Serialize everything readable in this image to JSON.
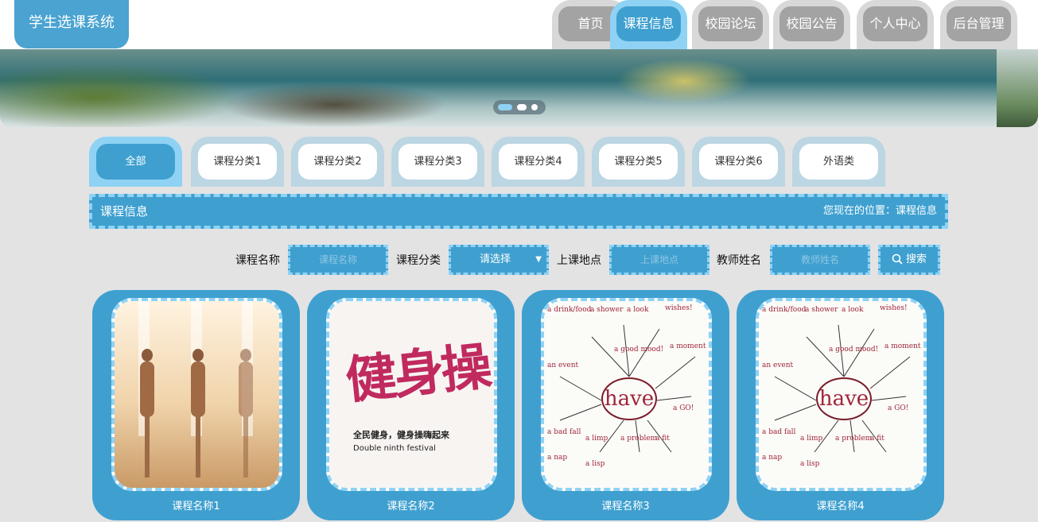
{
  "brand": "学生选课系统",
  "nav": [
    {
      "label": "首页",
      "active": false
    },
    {
      "label": "课程信息",
      "active": true
    },
    {
      "label": "校园论坛",
      "active": false
    },
    {
      "label": "校园公告",
      "active": false
    },
    {
      "label": "个人中心",
      "active": false
    },
    {
      "label": "后台管理",
      "active": false
    }
  ],
  "categories": [
    {
      "label": "全部",
      "active": true
    },
    {
      "label": "课程分类1"
    },
    {
      "label": "课程分类2"
    },
    {
      "label": "课程分类3"
    },
    {
      "label": "课程分类4"
    },
    {
      "label": "课程分类5"
    },
    {
      "label": "课程分类6"
    },
    {
      "label": "外语类"
    }
  ],
  "section": {
    "title": "课程信息",
    "breadcrumb": "您现在的位置：课程信息"
  },
  "search": {
    "course_name_label": "课程名称",
    "course_name_placeholder": "课程名称",
    "category_label": "课程分类",
    "category_selected": "请选择",
    "location_label": "上课地点",
    "location_placeholder": "上课地点",
    "teacher_label": "教师姓名",
    "teacher_placeholder": "教师姓名",
    "button": "搜索"
  },
  "courses": [
    {
      "name": "课程名称1"
    },
    {
      "name": "课程名称2"
    },
    {
      "name": "课程名称3"
    },
    {
      "name": "课程名称4"
    }
  ],
  "fitness_poster": {
    "headline": "健身操",
    "slogan": "全民健身，健身操嗨起来",
    "subtitle": "Double ninth festival"
  },
  "have_poster": {
    "center": "have",
    "words": [
      "a drink/food",
      "a shower",
      "a look",
      "wishes!",
      "a good mood!",
      "a moment",
      "an event",
      "a GO!",
      "a bad fall",
      "a limp",
      "a problem",
      "a fit",
      "a nap",
      "a lisp"
    ]
  },
  "colors": {
    "primary": "#3fa0d0",
    "accent": "#8fd2f4",
    "inactive_tab": "#a3a3a3"
  }
}
